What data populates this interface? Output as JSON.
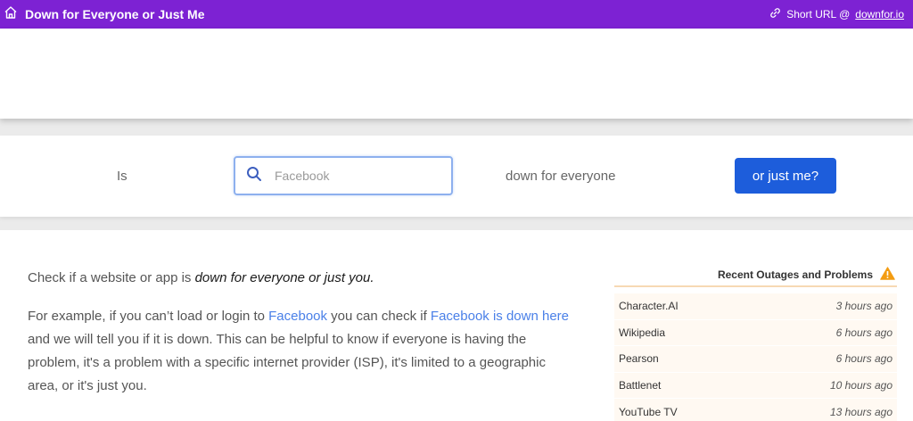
{
  "header": {
    "title": "Down for Everyone or Just Me",
    "home_icon": "home-icon",
    "short_url_prefix": "Short URL @ ",
    "short_url_link": "downfor.io",
    "link_icon": "link-icon"
  },
  "search": {
    "is_label": "Is",
    "placeholder": "Facebook",
    "value": "",
    "search_icon": "search-icon",
    "down_label": "down for everyone",
    "button_label": "or just me?"
  },
  "main": {
    "intro_prefix": "Check if a website or app is ",
    "intro_emphasis": "down for everyone or just you.",
    "explain_part1": "For example, if you can’t load or login to ",
    "explain_link1": "Facebook",
    "explain_part2": " you can check if ",
    "explain_link2": "Facebook is down here",
    "explain_part3": " and we will tell you if it is down. This can be helpful to know if everyone is having the problem, it's a problem with a specific internet provider (ISP), it's limited to a geographic area, or it's just you."
  },
  "outages": {
    "title": "Recent Outages and Problems",
    "warning_icon": "warning-icon",
    "accent_color": "#f39c12",
    "items": [
      {
        "name": "Character.AI",
        "time": "3 hours ago"
      },
      {
        "name": "Wikipedia",
        "time": "6 hours ago"
      },
      {
        "name": "Pearson",
        "time": "6 hours ago"
      },
      {
        "name": "Battlenet",
        "time": "10 hours ago"
      },
      {
        "name": "YouTube TV",
        "time": "13 hours ago"
      }
    ]
  },
  "colors": {
    "header_bg": "#7d22d3",
    "button_bg": "#1d5ddb",
    "link": "#4a80e8"
  }
}
